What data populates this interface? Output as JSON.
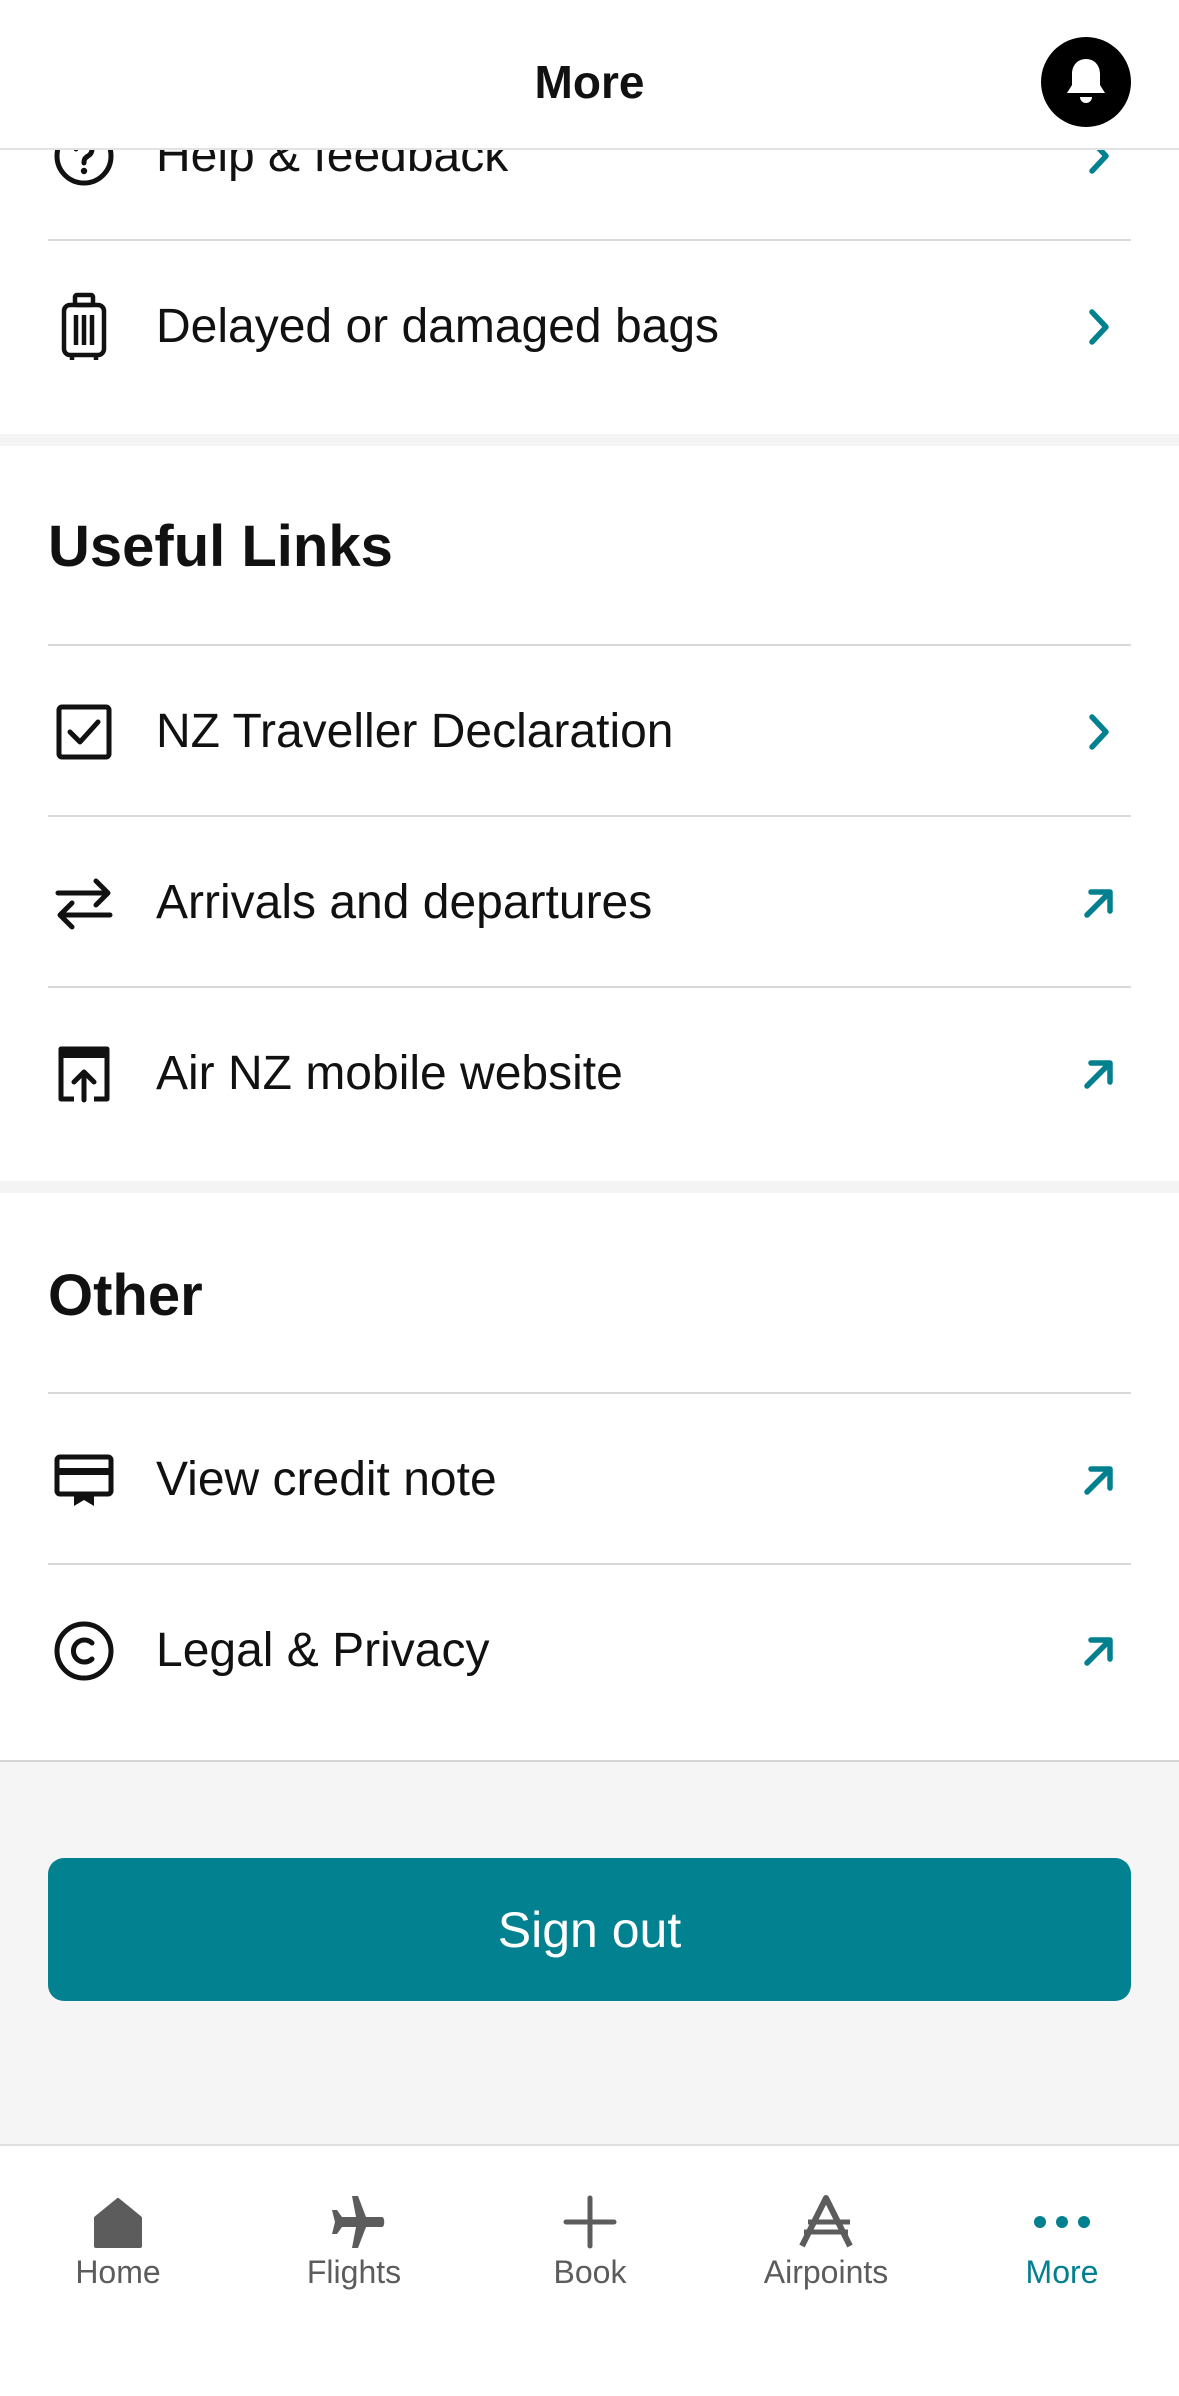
{
  "header": {
    "title": "More"
  },
  "support_items": [
    {
      "label": "Help & feedback",
      "icon": "help-icon",
      "trail": "chevron-right-icon"
    },
    {
      "label": "Delayed or damaged bags",
      "icon": "luggage-icon",
      "trail": "chevron-right-icon"
    }
  ],
  "useful_links": {
    "title": "Useful Links",
    "items": [
      {
        "label": "NZ Traveller Declaration",
        "icon": "checkbox-icon",
        "trail": "chevron-right-icon"
      },
      {
        "label": "Arrivals and departures",
        "icon": "swap-arrows-icon",
        "trail": "external-link-icon"
      },
      {
        "label": "Air NZ mobile website",
        "icon": "open-in-browser-icon",
        "trail": "external-link-icon"
      }
    ]
  },
  "other": {
    "title": "Other",
    "items": [
      {
        "label": "View credit note",
        "icon": "credit-note-icon",
        "trail": "external-link-icon"
      },
      {
        "label": "Legal & Privacy",
        "icon": "copyright-icon",
        "trail": "external-link-icon"
      }
    ]
  },
  "sign_out": {
    "label": "Sign out"
  },
  "tabs": [
    {
      "label": "Home",
      "icon": "home-icon"
    },
    {
      "label": "Flights",
      "icon": "plane-icon"
    },
    {
      "label": "Book",
      "icon": "plus-icon"
    },
    {
      "label": "Airpoints",
      "icon": "airpoints-icon"
    },
    {
      "label": "More",
      "icon": "more-dots-icon",
      "active": true
    }
  ],
  "colors": {
    "accent": "#03808F",
    "text": "#111111",
    "tab_inactive": "#5C5C5C",
    "footer_bg": "#F5F5F5"
  }
}
